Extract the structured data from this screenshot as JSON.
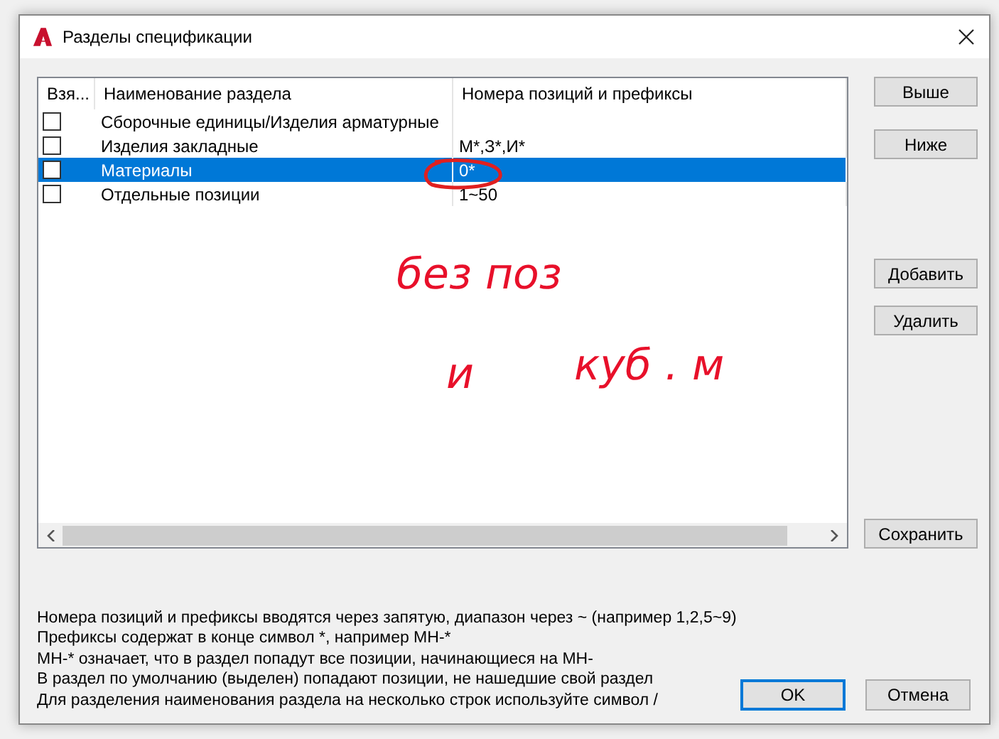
{
  "dialog": {
    "title": "Разделы спецификации"
  },
  "table": {
    "columns": [
      "Взя...",
      "Наименование раздела",
      "Номера позиций и префиксы"
    ],
    "rows": [
      {
        "checked": false,
        "selected": false,
        "name": "Сборочные единицы/Изделия арматурные",
        "numbers": ""
      },
      {
        "checked": false,
        "selected": false,
        "name": "Изделия закладные",
        "numbers": "М*,З*,И*"
      },
      {
        "checked": false,
        "selected": true,
        "name": "Материалы",
        "numbers": "0*"
      },
      {
        "checked": false,
        "selected": false,
        "name": "Отдельные позиции",
        "numbers": "1~50"
      }
    ]
  },
  "side_buttons": [
    {
      "label": "Выше",
      "kind": "top"
    },
    {
      "label": "Ниже",
      "kind": "top"
    },
    {
      "label": "Добавить",
      "kind": "middle"
    },
    {
      "label": "Удалить",
      "kind": "middle"
    },
    {
      "label": "Сохранить",
      "kind": "bottom"
    }
  ],
  "notes": [
    "Номера позиций и префиксы вводятся через запятую, диапазон через ~ (например 1,2,5~9)",
    "Префиксы содержат в конце символ *, например МН-*",
    "МН-* означает, что в раздел попадут все позиции, начинающиеся на МН-",
    "В раздел по умолчанию (выделен) попадают позиции, не нашедшие свой раздел",
    "Для разделения наименования раздела на несколько строк используйте символ /"
  ],
  "footer_buttons": [
    {
      "label": "OK",
      "default": true
    },
    {
      "label": "Отмена",
      "default": false
    }
  ],
  "handwritten_annotations": [
    "без поз",
    "и",
    "куб . м"
  ]
}
